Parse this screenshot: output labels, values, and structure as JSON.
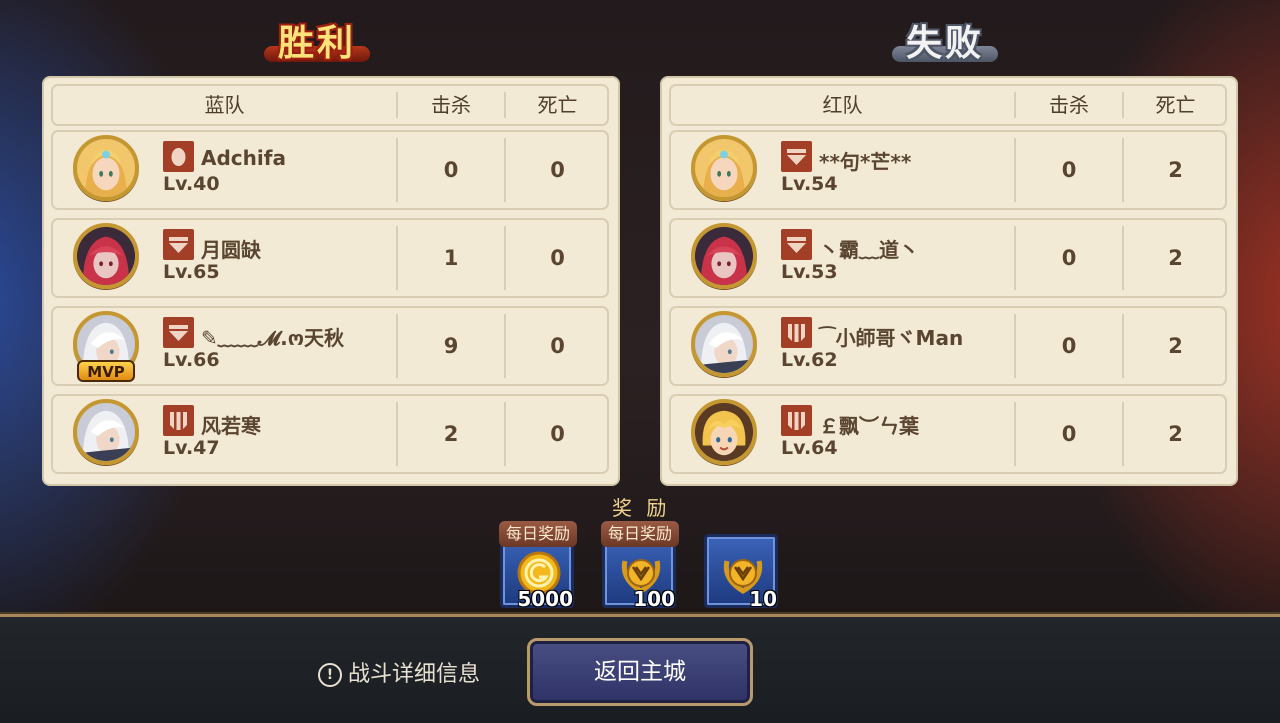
{
  "result": {
    "win_title": "胜利",
    "lose_title": "失败"
  },
  "blue_team": {
    "header": {
      "team": "蓝队",
      "kills": "击杀",
      "deaths": "死亡"
    },
    "players": [
      {
        "name": "Adchifa",
        "level": "Lv.40",
        "kills": "0",
        "deaths": "0",
        "avatar": "blonde-elf-avatar",
        "rank_icon": "egg-rank-icon"
      },
      {
        "name": "月圆缺",
        "level": "Lv.65",
        "kills": "1",
        "deaths": "0",
        "avatar": "red-hair-horned-avatar",
        "rank_icon": "chevron-rank-icon"
      },
      {
        "name": "✎﹏﹏𝓜.ო天秋",
        "level": "Lv.66",
        "kills": "9",
        "deaths": "0",
        "avatar": "white-hair-avatar",
        "rank_icon": "chevron-rank-icon",
        "badge": "MVP"
      },
      {
        "name": "风若寒",
        "level": "Lv.47",
        "kills": "2",
        "deaths": "0",
        "avatar": "white-hair-avatar",
        "rank_icon": "crown-rank-icon"
      }
    ]
  },
  "red_team": {
    "header": {
      "team": "红队",
      "kills": "击杀",
      "deaths": "死亡"
    },
    "players": [
      {
        "name": "**句*芒**",
        "level": "Lv.54",
        "kills": "0",
        "deaths": "2",
        "avatar": "blonde-elf-avatar",
        "rank_icon": "chevron-rank-icon"
      },
      {
        "name": "丶霸﹏道丶",
        "level": "Lv.53",
        "kills": "0",
        "deaths": "2",
        "avatar": "red-hair-horned-avatar",
        "rank_icon": "chevron-rank-icon"
      },
      {
        "name": "⁀小師哥ヾMan",
        "level": "Lv.62",
        "kills": "0",
        "deaths": "2",
        "avatar": "white-hair-avatar",
        "rank_icon": "crown-rank-icon"
      },
      {
        "name": "￡飘︶ㄣ葉",
        "level": "Lv.64",
        "kills": "0",
        "deaths": "2",
        "avatar": "blonde-boy-avatar",
        "rank_icon": "crown-rank-icon"
      }
    ]
  },
  "rewards": {
    "label": "奖 励",
    "items": [
      {
        "tag": "每日奖励",
        "amount": "5000",
        "icon": "gold-coin-icon"
      },
      {
        "tag": "每日奖励",
        "amount": "100",
        "icon": "laurel-medal-icon"
      },
      {
        "tag": "",
        "amount": "10",
        "icon": "laurel-medal-icon"
      }
    ]
  },
  "footer": {
    "detail_label": "战斗详细信息",
    "detail_icon": "info-icon",
    "return_label": "返回主城"
  },
  "colors": {
    "panel": "#f3ead6",
    "text": "#5a4630",
    "rank_badge": "#a33f26",
    "button": "#3b3f75"
  }
}
